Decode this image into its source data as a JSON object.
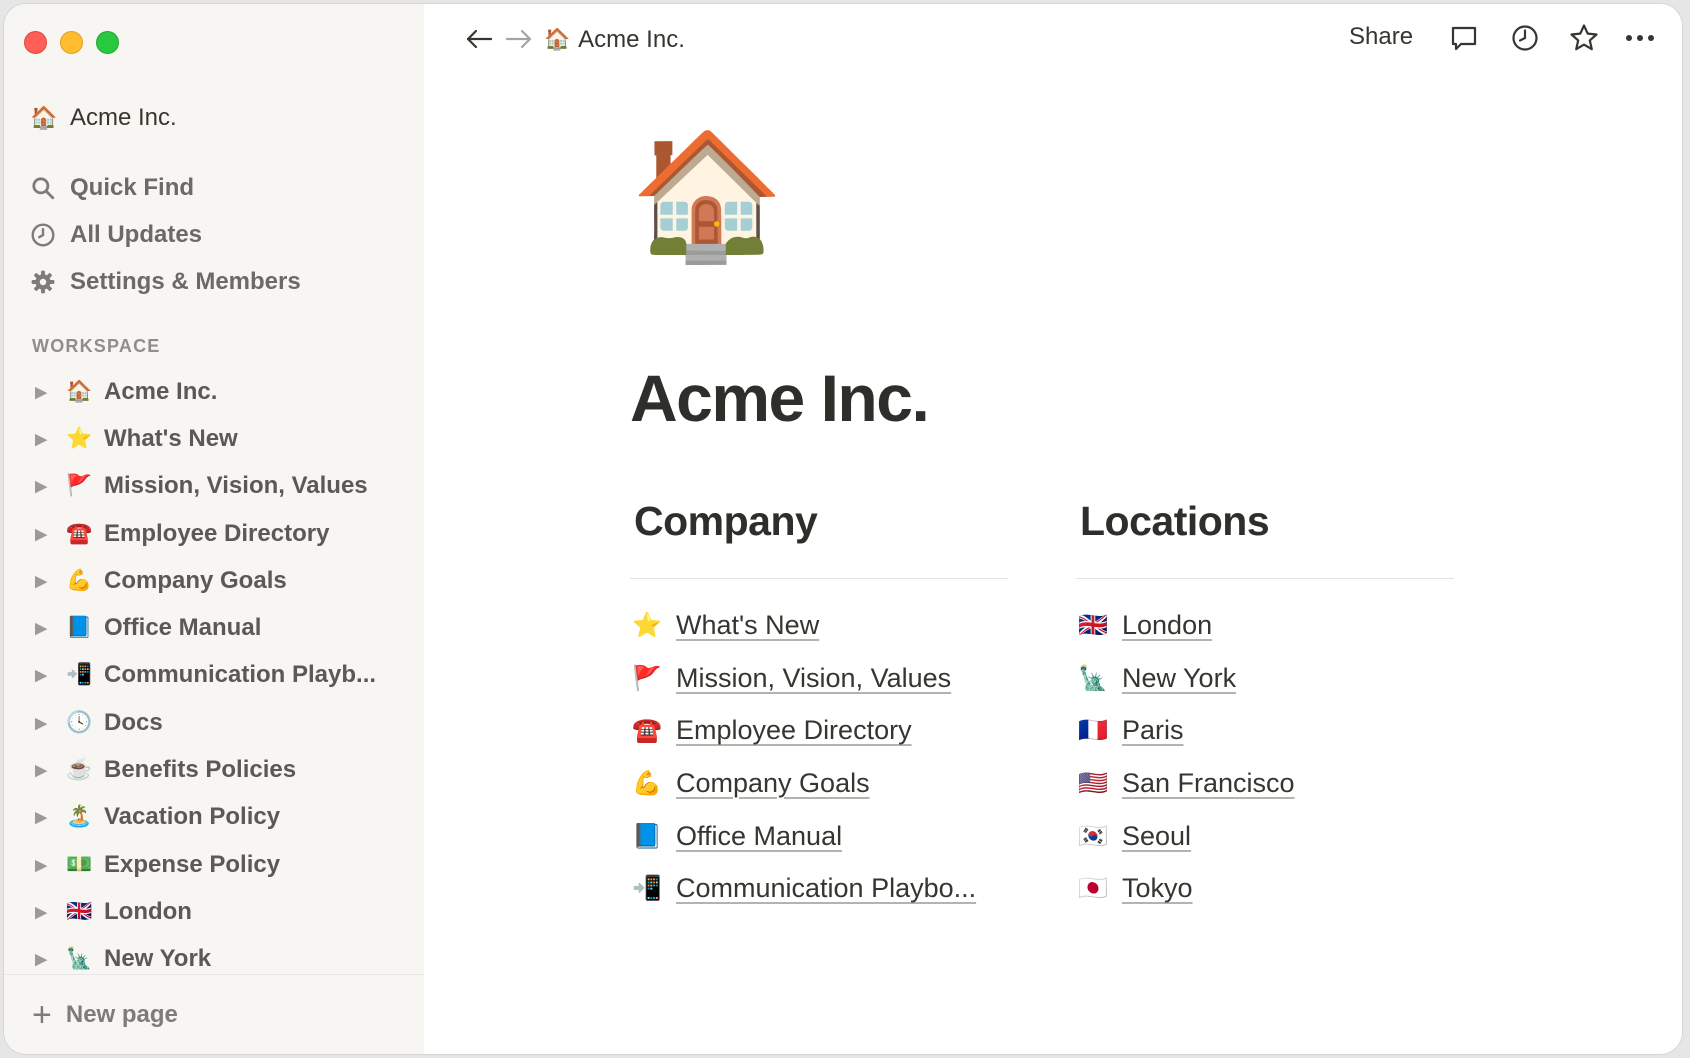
{
  "sidebar": {
    "workspace_name": "Acme Inc.",
    "workspace_emoji": "🏠",
    "nav": [
      {
        "label": "Quick Find",
        "icon": "search-icon"
      },
      {
        "label": "All Updates",
        "icon": "clock-icon"
      },
      {
        "label": "Settings & Members",
        "icon": "gear-icon"
      }
    ],
    "section_label": "WORKSPACE",
    "pages": [
      {
        "emoji": "🏠",
        "label": "Acme Inc."
      },
      {
        "emoji": "⭐",
        "label": "What's New"
      },
      {
        "emoji": "🚩",
        "label": "Mission, Vision, Values"
      },
      {
        "emoji": "☎️",
        "label": "Employee Directory"
      },
      {
        "emoji": "💪",
        "label": "Company Goals"
      },
      {
        "emoji": "📘",
        "label": "Office Manual"
      },
      {
        "emoji": "📲",
        "label": "Communication Playb..."
      },
      {
        "emoji": "🕓",
        "label": "Docs"
      },
      {
        "emoji": "☕",
        "label": "Benefits Policies"
      },
      {
        "emoji": "🏝️",
        "label": "Vacation Policy"
      },
      {
        "emoji": "💵",
        "label": "Expense Policy"
      },
      {
        "emoji": "🇬🇧",
        "label": "London"
      },
      {
        "emoji": "🗽",
        "label": "New York"
      }
    ],
    "new_page_label": "New page"
  },
  "topbar": {
    "breadcrumb_emoji": "🏠",
    "breadcrumb": "Acme Inc.",
    "share_label": "Share"
  },
  "page": {
    "icon": "🏠",
    "title": "Acme Inc.",
    "columns": [
      {
        "heading": "Company",
        "links": [
          {
            "emoji": "⭐",
            "label": "What's New"
          },
          {
            "emoji": "🚩",
            "label": "Mission, Vision, Values"
          },
          {
            "emoji": "☎️",
            "label": "Employee Directory"
          },
          {
            "emoji": "💪",
            "label": "Company Goals"
          },
          {
            "emoji": "📘",
            "label": "Office Manual"
          },
          {
            "emoji": "📲",
            "label": "Communication Playbo..."
          }
        ]
      },
      {
        "heading": "Locations",
        "links": [
          {
            "emoji": "🇬🇧",
            "label": "London"
          },
          {
            "emoji": "🗽",
            "label": "New York"
          },
          {
            "emoji": "🇫🇷",
            "label": "Paris"
          },
          {
            "emoji": "🇺🇸",
            "label": "San Francisco"
          },
          {
            "emoji": "🇰🇷",
            "label": "Seoul"
          },
          {
            "emoji": "🇯🇵",
            "label": "Tokyo"
          }
        ]
      }
    ]
  },
  "colors": {
    "sidebar_bg": "#f7f6f3",
    "text": "#37352f",
    "muted_text": "#6b6a66"
  }
}
